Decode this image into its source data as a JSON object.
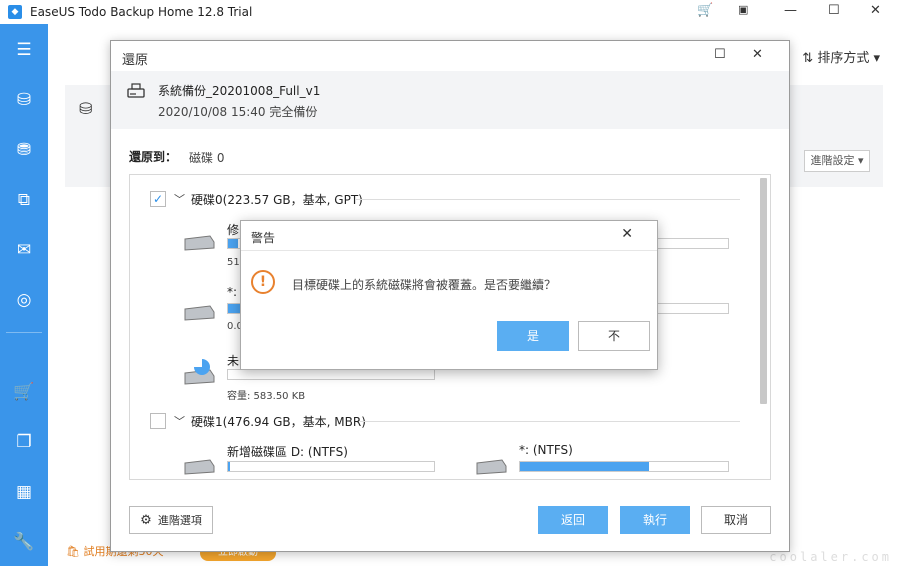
{
  "window": {
    "title": "EaseUS Todo Backup Home 12.8 Trial"
  },
  "main": {
    "sort_label": "排序方式",
    "advanced_settings": "進階設定"
  },
  "trial": {
    "text": "試用期還剩30天",
    "activate": "立即啟動"
  },
  "watermark": "coolaler.com",
  "restore_dialog": {
    "title": "還原",
    "source": {
      "name": "系統備份_20201008_Full_v1",
      "date": "2020/10/08 15:40 完全備份"
    },
    "restore_to_label": "還原到：",
    "restore_to_value": "磁碟 0",
    "disks": [
      {
        "header": "硬碟0(223.57 GB，基本, GPT)",
        "checked": true,
        "partitions": [
          {
            "name": "修",
            "capacity": "51",
            "fill": 0.02
          },
          {
            "name": "*: (",
            "capacity": "0.0",
            "fill": 0.06
          },
          {
            "name": "未",
            "capacity": "容量: 583.50 KB",
            "fill": 0.0
          }
        ]
      },
      {
        "header": "硬碟1(476.94 GB，基本, MBR)",
        "checked": false,
        "partitions": [
          {
            "name": "新增磁碟區 D: (NTFS)",
            "fill": 0.01
          },
          {
            "name": "*: (NTFS)",
            "fill": 0.62
          }
        ]
      }
    ],
    "advanced_options": "進階選項",
    "back": "返回",
    "execute": "執行",
    "cancel": "取消"
  },
  "warning": {
    "title": "警告",
    "message": "目標硬碟上的系統磁碟將會被覆蓋。是否要繼續？",
    "yes": "是",
    "no": "不"
  }
}
